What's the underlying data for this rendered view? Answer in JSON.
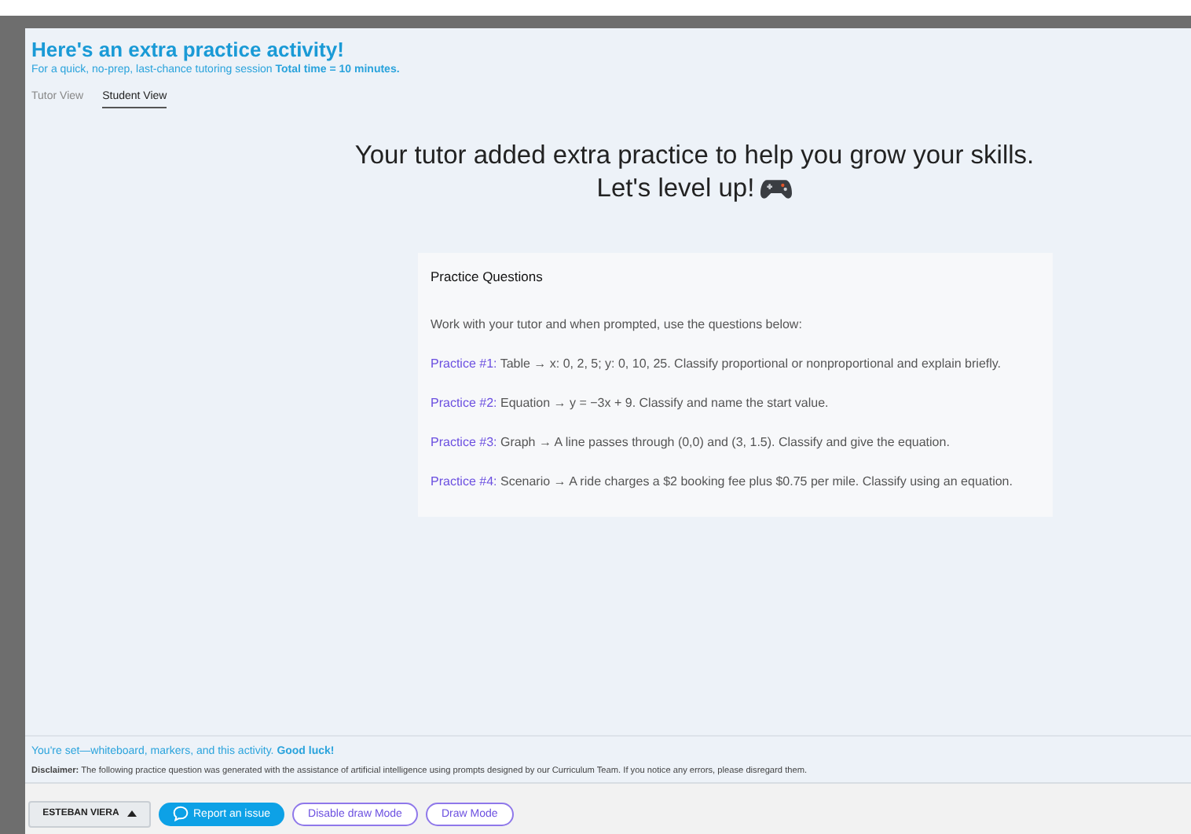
{
  "header": {
    "title": "Here's an extra practice activity!",
    "subtitle": "For a quick, no-prep, last-chance tutoring session **Total time = 10 minutes.**"
  },
  "tabs": [
    {
      "label": "Tutor View",
      "selected": false
    },
    {
      "label": "Student View",
      "selected": true
    }
  ],
  "headline": {
    "line_1": "Your tutor added extra practice to help you grow your skills.",
    "line_2": "Let's level up!"
  },
  "card": {
    "title": "Practice Questions",
    "intro": "Work with your tutor and when prompted, use the questions below:",
    "items": [
      {
        "label": "Practice #1:",
        "text": "Table → x: 0, 2, 5; y: 0, 10, 25. Classify proportional or nonproportional and explain briefly."
      },
      {
        "label": "Practice #2:",
        "text": "Equation → y = −3x + 9. Classify and name the start value."
      },
      {
        "label": "Practice #3:",
        "text": "Graph → A line passes through (0,0) and (3, 1.5). Classify and give the equation."
      },
      {
        "label": "Practice #4:",
        "text": "Scenario → A ride charges a $2 booking fee plus $0.75 per mile. Classify using an equation."
      }
    ]
  },
  "footer_note": "You're set—whiteboard, markers, and this activity. **Good luck!**",
  "disclaimer": "**Disclaimer:** The following practice question was generated with the assistance of artificial intelligence using prompts designed by our Curriculum Team. If you notice any errors, please disregard them.",
  "toolbar": {
    "user": "ESTEBAN VIERA",
    "buttons": [
      {
        "kind": "primary",
        "label": "Report an issue"
      },
      {
        "kind": "outline",
        "label": "Disable draw Mode"
      },
      {
        "kind": "outline",
        "label": "Draw Mode"
      }
    ]
  }
}
